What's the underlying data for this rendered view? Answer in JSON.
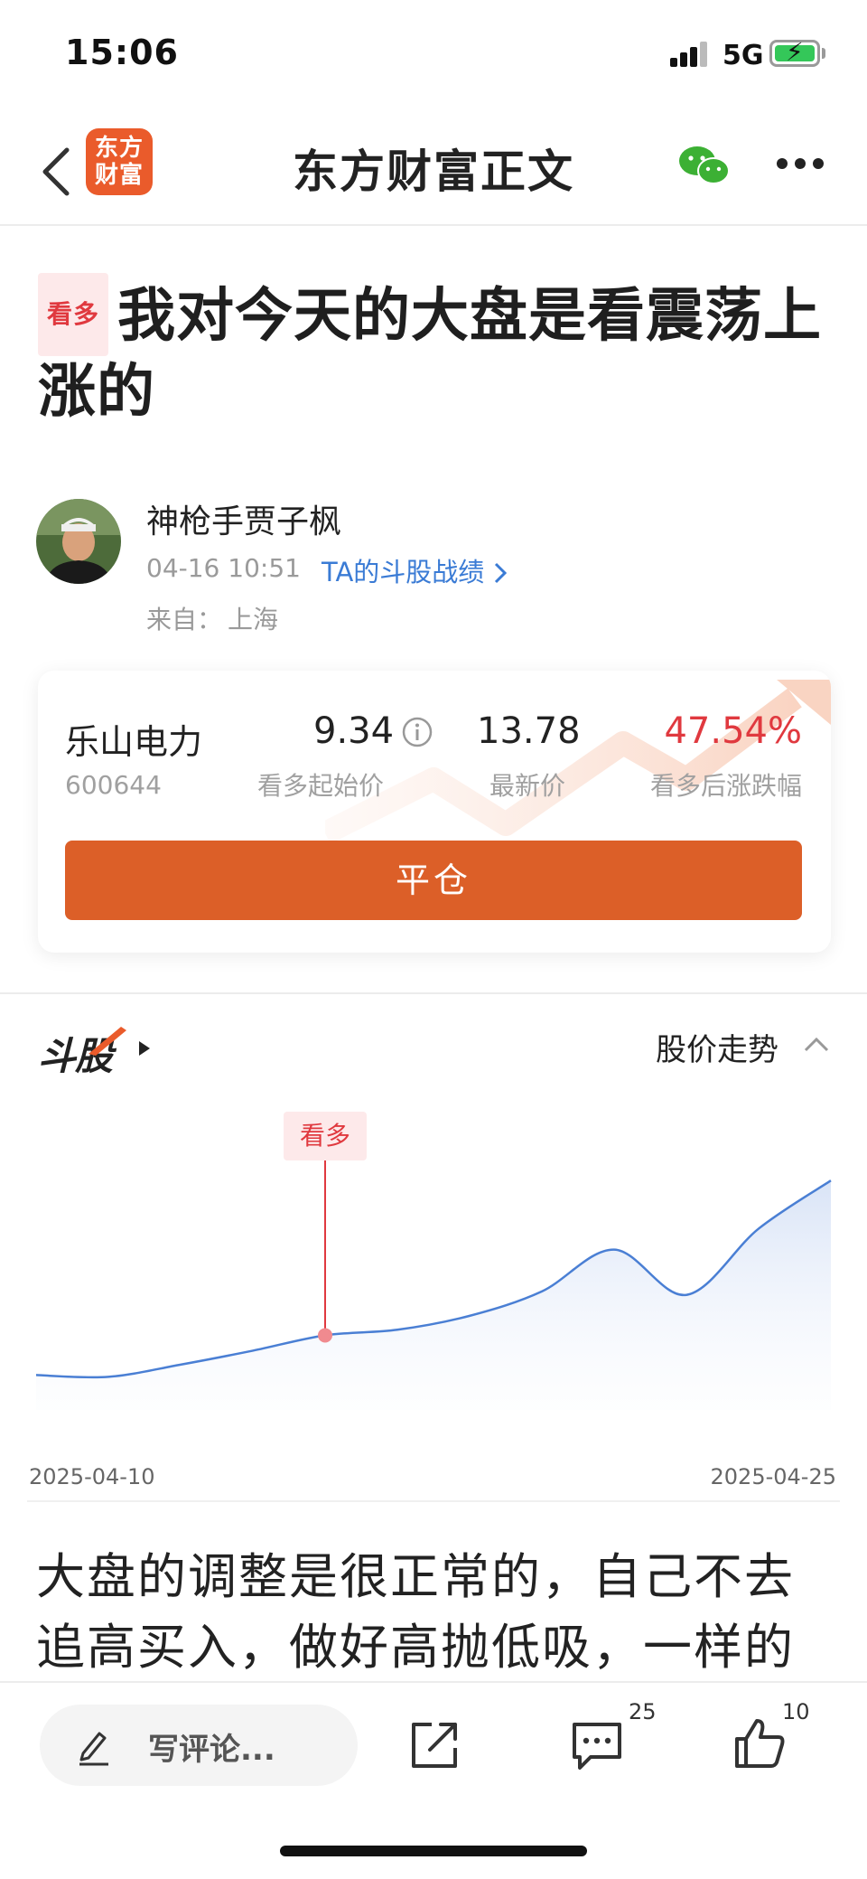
{
  "status_bar": {
    "time": "15:06",
    "network": "5G"
  },
  "nav": {
    "title": "东方财富正文",
    "logo_text": "东方财富"
  },
  "article": {
    "tag": "看多",
    "title": "我对今天的大盘是看震荡上涨的",
    "body": "大盘的调整是很正常的，自己不去追高买入，做好高抛低吸，一样的"
  },
  "author": {
    "name": "神枪手贾子枫",
    "time": "04-16 10:51",
    "record_link": "TA的斗股战绩",
    "from_label": "来自：",
    "from_value": "上海"
  },
  "stock_card": {
    "name": "乐山电力",
    "code": "600644",
    "start_price": "9.34",
    "start_label": "看多起始价",
    "latest_price": "13.78",
    "latest_label": "最新价",
    "change": "47.54%",
    "change_label": "看多后涨跌幅",
    "close_button": "平仓",
    "accent_color": "#dc5f28",
    "up_color": "#e0393f"
  },
  "trend": {
    "logo": "斗股",
    "label": "股价走势",
    "marker_label": "看多",
    "start_date": "2025-04-10",
    "end_date": "2025-04-25"
  },
  "chart_data": {
    "type": "line",
    "x": [
      "2025-04-10",
      "2025-04-11",
      "2025-04-14",
      "2025-04-15",
      "2025-04-16",
      "2025-04-17",
      "2025-04-18",
      "2025-04-21",
      "2025-04-22",
      "2025-04-23",
      "2025-04-24",
      "2025-04-25"
    ],
    "series": [
      {
        "values": [
          8.2,
          8.15,
          8.5,
          8.9,
          9.34,
          9.5,
          9.9,
          10.6,
          11.8,
          10.5,
          12.4,
          13.78
        ]
      }
    ],
    "marker": {
      "x": "2025-04-16",
      "label": "看多"
    },
    "line_color": "#4a7fd4"
  },
  "toolbar": {
    "comment_placeholder": "写评论...",
    "comment_count": "25",
    "like_count": "10"
  }
}
